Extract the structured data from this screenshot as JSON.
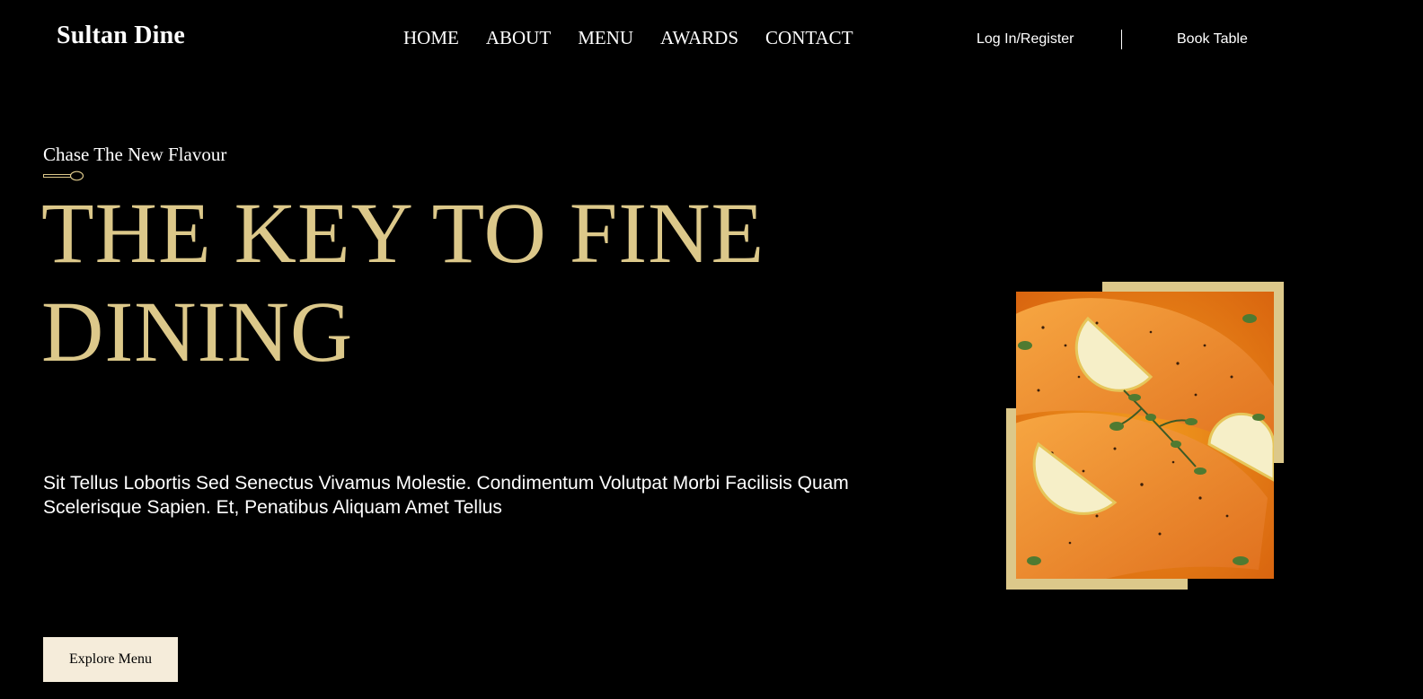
{
  "header": {
    "brand": "Sultan Dine",
    "nav": [
      {
        "label": "HOME"
      },
      {
        "label": "ABOUT"
      },
      {
        "label": "MENU"
      },
      {
        "label": "AWARDS"
      },
      {
        "label": "CONTACT"
      }
    ],
    "login_label": "Log In/Register",
    "book_label": "Book Table"
  },
  "hero": {
    "tagline": "Chase The New Flavour",
    "headline": "THE KEY TO FINE DINING",
    "description": "Sit Tellus Lobortis Sed Senectus Vivamus Molestie. Condimentum Volutpat Morbi Facilisis Quam Scelerisque Sapien. Et, Penatibus Aliquam Amet Tellus",
    "cta_label": "Explore Menu",
    "image_subject": "salmon fillets with lemon slices and herbs",
    "icons": {
      "divider_icon": "spoon-icon"
    }
  },
  "colors": {
    "background": "#000000",
    "accent_gold": "#dcc88a",
    "button_bg": "#f5ecda",
    "text": "#ffffff"
  }
}
